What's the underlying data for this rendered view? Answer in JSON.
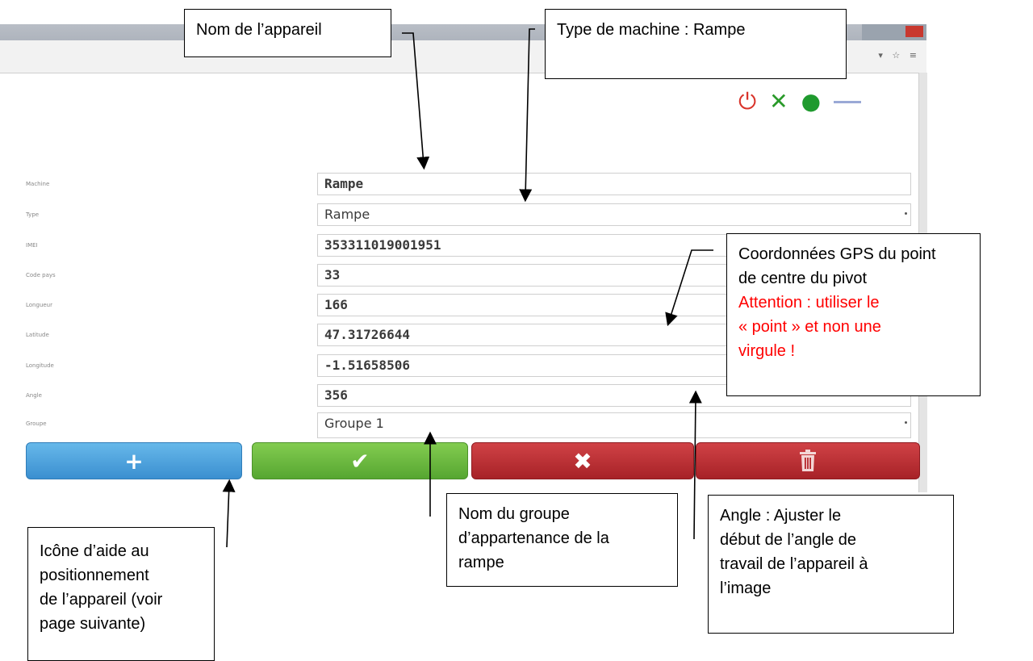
{
  "toolbar": {
    "icons": [
      "power-icon",
      "tools-icon",
      "eye-icon",
      "minus-icon"
    ],
    "colors": {
      "power": "#d9342b",
      "tools": "#2a9a2a",
      "eye": "#1f9a2e"
    }
  },
  "form": {
    "fields": [
      {
        "label": "Machine",
        "value": "Rampe"
      },
      {
        "label": "Type",
        "value": "Rampe"
      },
      {
        "label": "IMEI",
        "value": "353311019001951"
      },
      {
        "label": "Code pays",
        "value": "33"
      },
      {
        "label": "Longueur",
        "value": "166"
      },
      {
        "label": "Latitude",
        "value": "47.31726644"
      },
      {
        "label": "Longitude",
        "value": "-1.51658506"
      },
      {
        "label": "Angle",
        "value": "356"
      },
      {
        "label": "Groupe",
        "value": "Groupe 1"
      }
    ]
  },
  "actions": {
    "add_icon": "+",
    "confirm_icon": "✔",
    "cancel_icon": "✖",
    "delete_icon": "trash-icon",
    "colors": {
      "add": "#4aa0dc",
      "confirm": "#6ab93e",
      "cancel": "#bb2f33",
      "delete": "#bb2f33"
    }
  },
  "annotations": {
    "device_name": "Nom de l’appareil",
    "machine_type": "Type de machine : Rampe",
    "gps_line1": "Coordonnées GPS du point",
    "gps_line2": "de centre du pivot",
    "gps_warn1": "Attention : utiliser le",
    "gps_warn2": "« point » et non une",
    "gps_warn3": "virgule !",
    "help_line1": "Icône d’aide au",
    "help_line2": "positionnement",
    "help_line3": "de l’appareil (voir",
    "help_line4": "page suivante)",
    "group_line1": "Nom du groupe",
    "group_line2": "d’appartenance de la",
    "group_line3": "rampe",
    "angle_line1": "Angle : Ajuster  le",
    "angle_line2": "début de l’angle de",
    "angle_line3": "travail de l’appareil à",
    "angle_line4": "l’image"
  }
}
